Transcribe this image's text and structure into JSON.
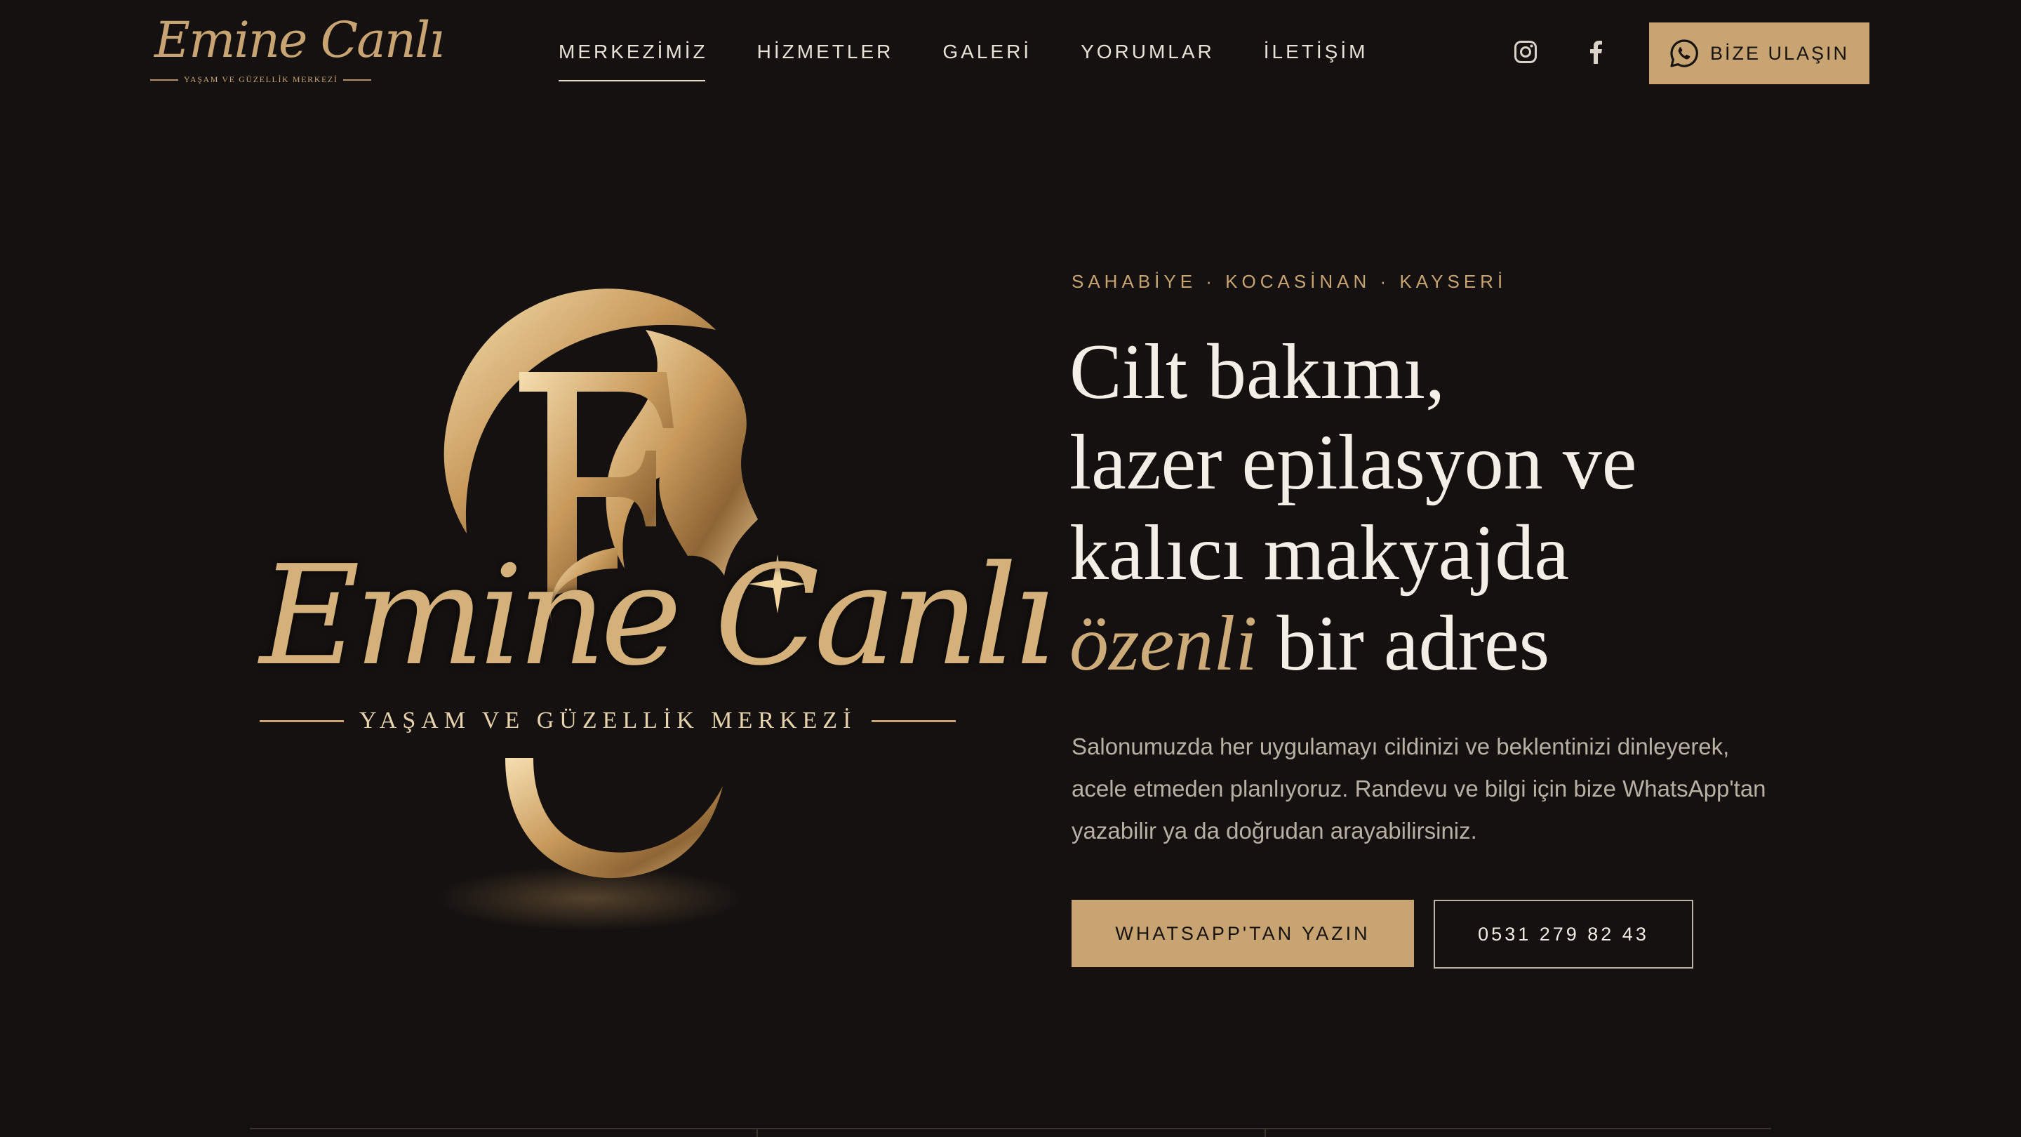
{
  "brand": {
    "name": "Emine Canlı",
    "tagline": "YAŞAM VE GÜZELLİK MERKEZİ"
  },
  "nav": {
    "items": [
      {
        "label": "MERKEZİMİZ",
        "active": true
      },
      {
        "label": "HİZMETLER",
        "active": false
      },
      {
        "label": "GALERİ",
        "active": false
      },
      {
        "label": "YORUMLAR",
        "active": false
      },
      {
        "label": "İLETİŞİM",
        "active": false
      }
    ]
  },
  "header": {
    "social_icons": [
      "instagram-icon",
      "facebook-icon"
    ],
    "contact_button": {
      "label": "BİZE ULAŞIN",
      "icon": "whatsapp-icon"
    }
  },
  "hero": {
    "emblem": {
      "monogram": "EC",
      "script": "Emine Canlı",
      "tagline": "YAŞAM VE GÜZELLİK MERKEZİ"
    },
    "location": "SAHABİYE · KOCASİNAN · KAYSERİ",
    "headline": {
      "line1": "Cilt bakımı,",
      "line2": "lazer epilasyon ve",
      "line3": "kalıcı makyajda",
      "accent": "özenli",
      "line4_rest": " bir adres"
    },
    "lead": "Salonumuzda her uygulamayı cildinizi ve beklentinizi dinleyerek, acele etmeden planlıyoruz. Randevu ve bilgi için bize WhatsApp'tan yazabilir ya da doğrudan arayabilirsiniz.",
    "primary_button": "WHATSAPP'TAN YAZIN",
    "secondary_button": "0531 279 82 43"
  },
  "colors": {
    "background": "#141110",
    "gold": "#c8a472",
    "text_light": "#f3eee6",
    "text_muted": "#b9b0a4"
  }
}
